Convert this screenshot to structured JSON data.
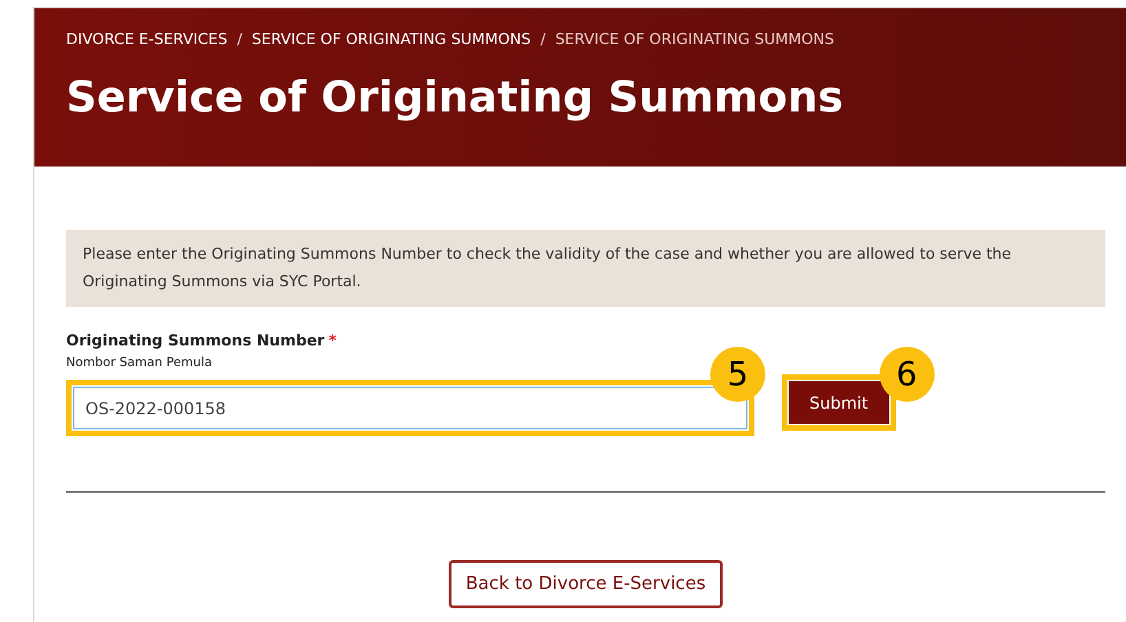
{
  "breadcrumb": [
    {
      "label": "DIVORCE E-SERVICES",
      "selected": false
    },
    {
      "label": "SERVICE OF ORIGINATING SUMMONS",
      "selected": false
    },
    {
      "label": "SERVICE OF ORIGINATING SUMMONS",
      "selected": true
    }
  ],
  "separator": "/",
  "title": "Service of Originating Summons",
  "info": "Please enter the Originating Summons Number to check the validity of the case and whether you are allowed to serve the Originating Summons via SYC Portal.",
  "field": {
    "label": "Originating Summons Number",
    "required_mark": "*",
    "sublabel": "Nombor Saman Pemula",
    "value": "OS-2022-000158",
    "callout": "5"
  },
  "submit": {
    "label": "Submit",
    "callout": "6"
  },
  "back_button": "Back to Divorce E-Services"
}
